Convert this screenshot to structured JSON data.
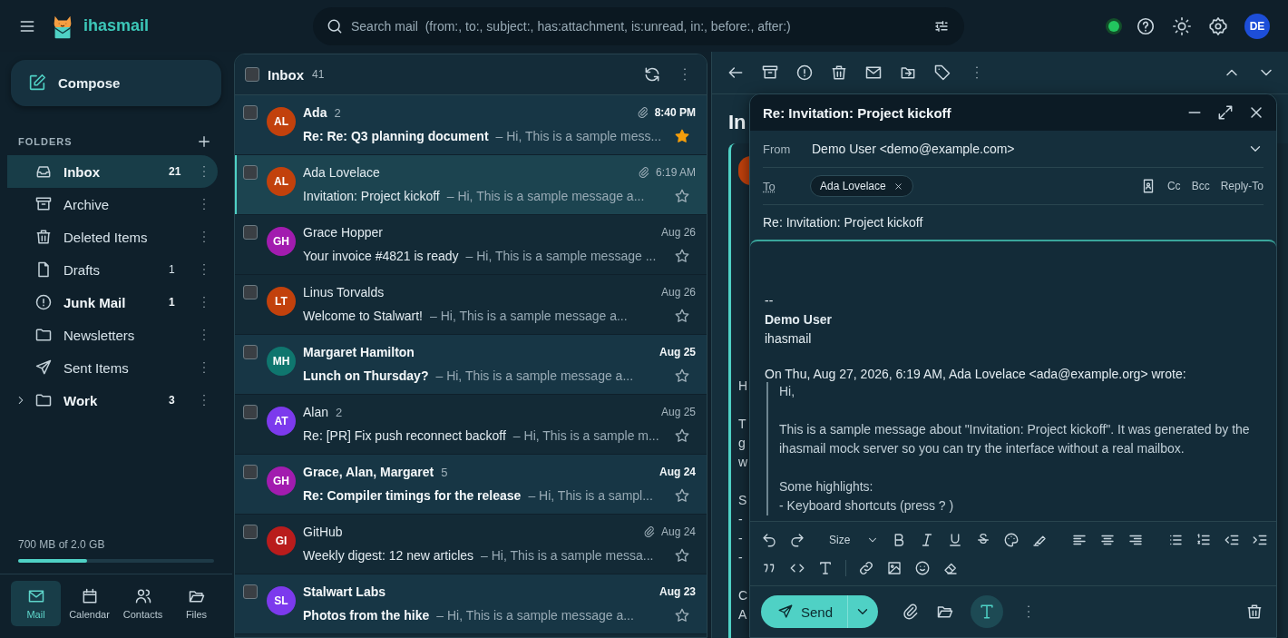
{
  "app": {
    "name": "ihasmail"
  },
  "search": {
    "placeholder": "Search mail  (from:, to:, subject:, has:attachment, is:unread, in:, before:, after:)"
  },
  "status": {
    "online": true
  },
  "user": {
    "initials": "DE"
  },
  "compose_button": "Compose",
  "folders_label": "FOLDERS",
  "folders": [
    {
      "name": "Inbox",
      "kind": "inbox",
      "count": "21",
      "unread": true,
      "selected": true
    },
    {
      "name": "Archive",
      "kind": "archive",
      "unread": false,
      "selected": false
    },
    {
      "name": "Deleted Items",
      "kind": "trash",
      "unread": false,
      "selected": false
    },
    {
      "name": "Drafts",
      "kind": "drafts",
      "count": "1",
      "unread": false,
      "selected": false
    },
    {
      "name": "Junk Mail",
      "kind": "junk",
      "count": "1",
      "unread": true,
      "selected": false
    },
    {
      "name": "Newsletters",
      "kind": "folder",
      "unread": false,
      "selected": false
    },
    {
      "name": "Sent Items",
      "kind": "sent",
      "unread": false,
      "selected": false
    },
    {
      "name": "Work",
      "kind": "folder",
      "count": "3",
      "unread": true,
      "selected": false,
      "expanded": false
    }
  ],
  "storage": {
    "label": "700 MB of 2.0 GB",
    "level": 0.35
  },
  "nav": [
    {
      "label": "Mail",
      "kind": "mail",
      "selected": true
    },
    {
      "label": "Calendar",
      "kind": "calendar",
      "selected": false
    },
    {
      "label": "Contacts",
      "kind": "contacts",
      "selected": false
    },
    {
      "label": "Files",
      "kind": "files",
      "selected": false
    }
  ],
  "list": {
    "title": "Inbox",
    "count": "41",
    "all_checked": false
  },
  "messages": [
    {
      "initials": "AL",
      "color": "#c2410c",
      "sender": "Ada",
      "thread": "2",
      "subject": "Re: Re: Q3 planning document",
      "snippet": "– Hi, This is a sample mess...",
      "date": "8:40 PM",
      "unread": true,
      "attachment": true,
      "starred": true,
      "checked": false,
      "selected": false
    },
    {
      "initials": "AL",
      "color": "#c2410c",
      "sender": "Ada Lovelace",
      "subject": "Invitation: Project kickoff",
      "snippet": "– Hi, This is a sample message a...",
      "date": "6:19 AM",
      "unread": false,
      "attachment": true,
      "starred": false,
      "checked": false,
      "selected": true
    },
    {
      "initials": "GH",
      "color": "#a21caf",
      "sender": "Grace Hopper",
      "subject": "Your invoice #4821 is ready",
      "snippet": "– Hi, This is a sample message ...",
      "date": "Aug 26",
      "unread": false,
      "attachment": false,
      "starred": false,
      "checked": false,
      "selected": false
    },
    {
      "initials": "LT",
      "color": "#c2410c",
      "sender": "Linus Torvalds",
      "subject": "Welcome to Stalwart!",
      "snippet": "– Hi, This is a sample message a...",
      "date": "Aug 26",
      "unread": false,
      "attachment": false,
      "starred": false,
      "checked": false,
      "selected": false
    },
    {
      "initials": "MH",
      "color": "#0f766e",
      "sender": "Margaret Hamilton",
      "subject": "Lunch on Thursday?",
      "snippet": "– Hi, This is a sample message a...",
      "date": "Aug 25",
      "unread": true,
      "attachment": false,
      "starred": false,
      "checked": false,
      "selected": false
    },
    {
      "initials": "AT",
      "color": "#7c3aed",
      "sender": "Alan",
      "thread": "2",
      "subject": "Re: [PR] Fix push reconnect backoff",
      "snippet": "– Hi, This is a sample m...",
      "date": "Aug 25",
      "unread": false,
      "attachment": false,
      "starred": false,
      "checked": false,
      "selected": false
    },
    {
      "initials": "GH",
      "color": "#a21caf",
      "sender": "Grace, Alan, Margaret",
      "thread": "5",
      "subject": "Re: Compiler timings for the release",
      "snippet": "– Hi, This is a sampl...",
      "date": "Aug 24",
      "unread": true,
      "attachment": false,
      "starred": false,
      "checked": false,
      "selected": false
    },
    {
      "initials": "GI",
      "color": "#b91c1c",
      "sender": "GitHub",
      "subject": "Weekly digest: 12 new articles",
      "snippet": "– Hi, This is a sample messa...",
      "date": "Aug 24",
      "unread": false,
      "attachment": true,
      "starred": false,
      "checked": false,
      "selected": false
    },
    {
      "initials": "SL",
      "color": "#7c3aed",
      "sender": "Stalwart Labs",
      "subject": "Photos from the hike",
      "snippet": "– Hi, This is a sample message a...",
      "date": "Aug 23",
      "unread": true,
      "attachment": false,
      "starred": false,
      "checked": false,
      "selected": false
    }
  ],
  "reader": {
    "heading": "In",
    "avatar": {
      "color": "#c2410c"
    },
    "fragments": [
      [
        "H"
      ],
      [
        "T",
        "g",
        "w"
      ],
      [
        "S",
        "-",
        "-",
        "-"
      ],
      [
        "C",
        "A"
      ]
    ]
  },
  "compose": {
    "title": "Re: Invitation: Project kickoff",
    "from_label": "From",
    "from": "Demo User <demo@example.com>",
    "to_label": "To",
    "recipients": [
      "Ada Lovelace"
    ],
    "field_links": [
      "Cc",
      "Bcc",
      "Reply-To"
    ],
    "subject": "Re: Invitation: Project kickoff",
    "signature": {
      "separator": "--",
      "name": "Demo User",
      "company": "ihasmail"
    },
    "quote_header": "On Thu, Aug 27, 2026, 6:19 AM, Ada Lovelace <ada@example.org> wrote:",
    "quote": [
      [
        "Hi,"
      ],
      [
        "This is a sample message about \"Invitation: Project kickoff\". It was generated by the ihasmail mock server so you can try the interface without a real mailbox."
      ],
      [
        "Some highlights:",
        "- Keyboard shortcuts (press ? )"
      ]
    ],
    "size_label": "Size",
    "send": "Send",
    "rich_text": true
  }
}
